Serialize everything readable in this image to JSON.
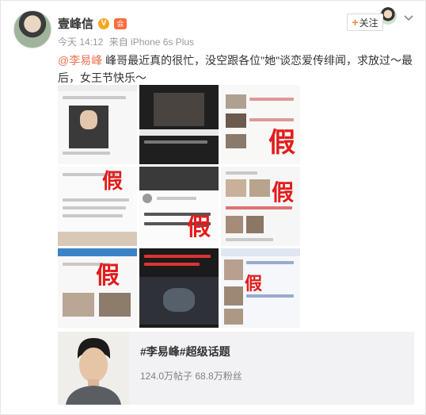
{
  "user": {
    "name": "壹峰信",
    "verified_badge": "V",
    "member_badge": "会"
  },
  "meta": {
    "time": "今天 14:12",
    "source": "来自 iPhone 6s Plus"
  },
  "follow": {
    "label": "关注"
  },
  "post": {
    "mention": "@李易峰",
    "text": " 峰哥最近真的很忙，没空跟各位\"她\"谈恋爱传绯闻，求放过～最后，女王节快乐～"
  },
  "images": {
    "fake_mark": "假",
    "count": 9
  },
  "topic": {
    "title": "#李易峰#超级话题",
    "stats": "124.0万帖子 68.8万粉丝"
  },
  "icons": {
    "verified": "verified-icon",
    "member": "member-icon",
    "chevron": "chevron-down-icon"
  },
  "colors": {
    "mention": "#eb7350",
    "fake_red": "#e31b1b",
    "follow_plus": "#ff8140"
  }
}
